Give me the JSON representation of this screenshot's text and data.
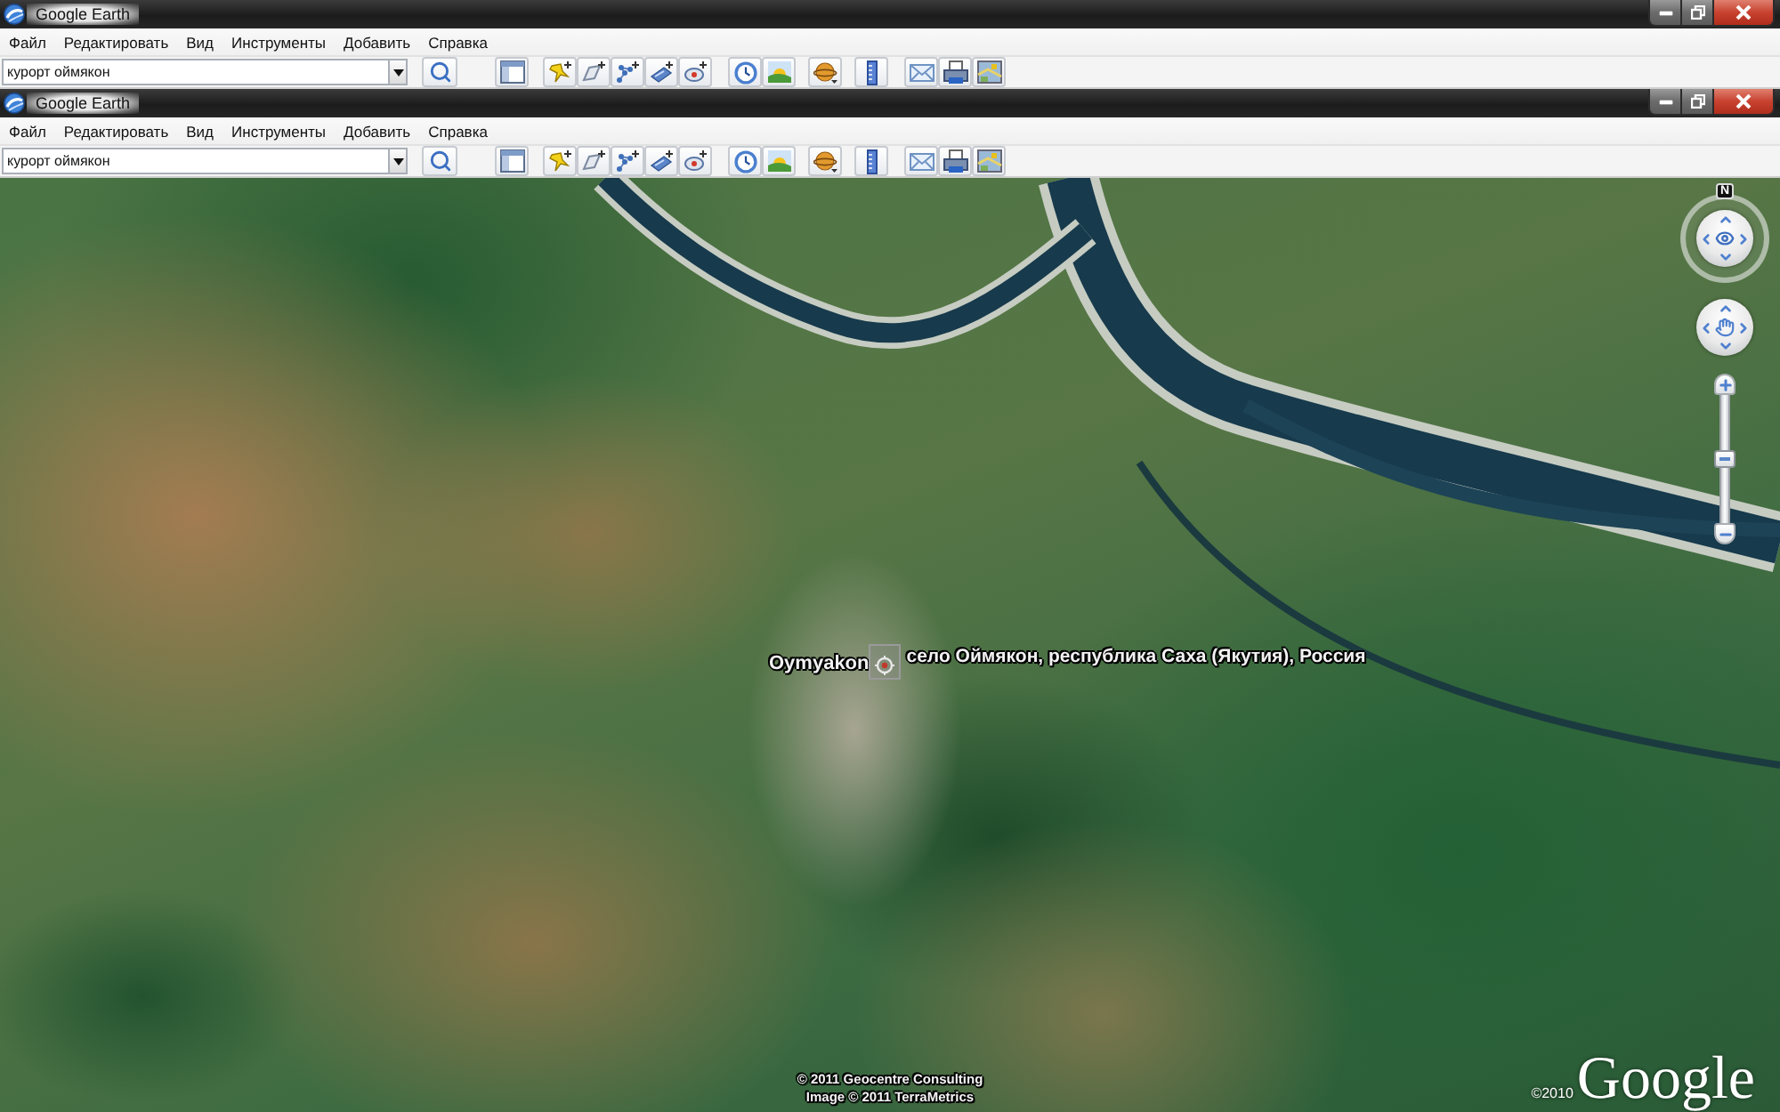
{
  "windows": [
    {
      "title": "Google Earth",
      "menu": [
        "Файл",
        "Редактировать",
        "Вид",
        "Инструменты",
        "Добавить",
        "Справка"
      ],
      "search": {
        "value": "курорт оймякон"
      }
    },
    {
      "title": "Google Earth",
      "menu": [
        "Файл",
        "Редактировать",
        "Вид",
        "Инструменты",
        "Добавить",
        "Справка"
      ],
      "search": {
        "value": "курорт оймякон"
      }
    }
  ],
  "map": {
    "place": {
      "name": "Oymyakon",
      "address": "село Оймякон, республика Саха (Якутия), Россия"
    },
    "navigation": {
      "north": "N",
      "zoom": {
        "level": 0.5
      }
    },
    "attribution": [
      "© 2011 Geocentre Consulting",
      "Image © 2011 TerraMetrics"
    ],
    "logo": {
      "year": "©2010",
      "name": "Google"
    }
  }
}
